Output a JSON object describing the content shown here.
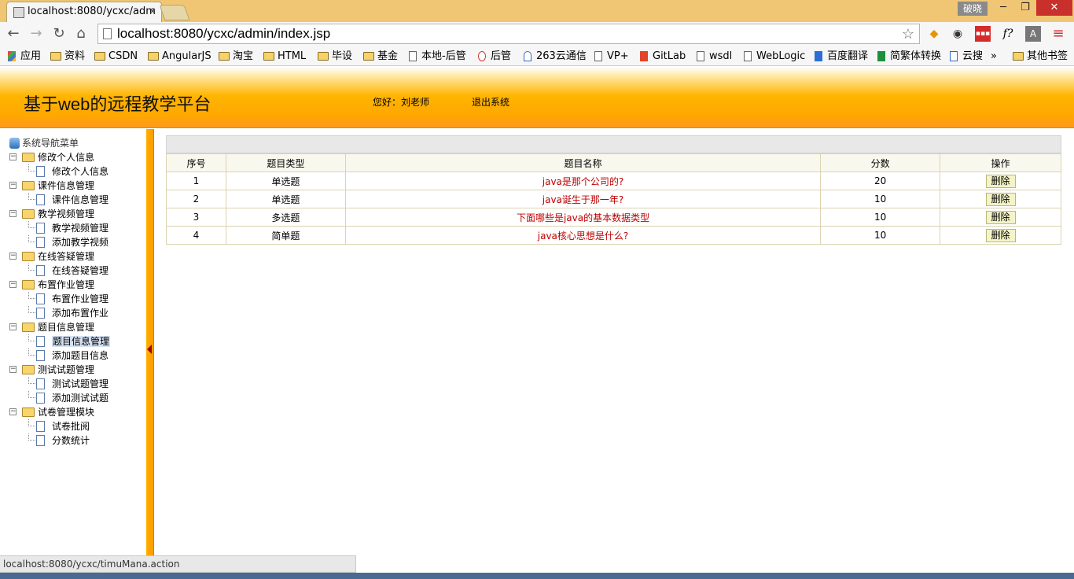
{
  "browser": {
    "tab_title": "localhost:8080/ycxc/adm",
    "tab_close": "×",
    "user_badge": "破晓",
    "window_min": "─",
    "window_max": "❐",
    "window_close": "✕",
    "nav_back": "←",
    "nav_forward": "→",
    "nav_reload": "↻",
    "nav_home": "⌂",
    "star": "☆",
    "url": "localhost:8080/ycxc/admin/index.jsp",
    "status_url": "localhost:8080/ycxc/timuMana.action",
    "bookmarks": [
      "应用",
      "资料",
      "CSDN",
      "AngularJS",
      "淘宝",
      "HTML",
      "毕设",
      "基金",
      "本地-后管",
      "后管",
      "263云通信",
      "VP+",
      "GitLab",
      "wsdl",
      "WebLogic",
      "百度翻译",
      "简繁体转换",
      "云搜",
      "»",
      "其他书签"
    ],
    "extensions": [
      "◆",
      "◉",
      "▪▪▪",
      "f?",
      "A",
      "≡"
    ]
  },
  "header": {
    "title": "基于web的远程教学平台",
    "greeting": "您好：刘老师",
    "logout": "退出系统"
  },
  "sidebar": {
    "root_label": "系统导航菜单",
    "folder_toggle": "−",
    "groups": [
      {
        "label": "修改个人信息",
        "items": [
          "修改个人信息"
        ]
      },
      {
        "label": "课件信息管理",
        "items": [
          "课件信息管理"
        ]
      },
      {
        "label": "教学视频管理",
        "items": [
          "教学视频管理",
          "添加教学视频"
        ]
      },
      {
        "label": "在线答疑管理",
        "items": [
          "在线答疑管理"
        ]
      },
      {
        "label": "布置作业管理",
        "items": [
          "布置作业管理",
          "添加布置作业"
        ]
      },
      {
        "label": "题目信息管理",
        "items": [
          "题目信息管理",
          "添加题目信息"
        ]
      },
      {
        "label": "测试试题管理",
        "items": [
          "测试试题管理",
          "添加测试试题"
        ]
      },
      {
        "label": "试卷管理模块",
        "items": [
          "试卷批阅",
          "分数统计"
        ]
      }
    ],
    "selected_item": "题目信息管理"
  },
  "table": {
    "headers": [
      "序号",
      "题目类型",
      "题目名称",
      "分数",
      "操作"
    ],
    "rows": [
      {
        "no": "1",
        "type": "单选题",
        "title": "java是那个公司的?",
        "score": "20",
        "action": "删除"
      },
      {
        "no": "2",
        "type": "单选题",
        "title": "java诞生于那一年?",
        "score": "10",
        "action": "删除"
      },
      {
        "no": "3",
        "type": "多选题",
        "title": "下面哪些是java的基本数据类型",
        "score": "10",
        "action": "删除"
      },
      {
        "no": "4",
        "type": "简单题",
        "title": "java核心思想是什么?",
        "score": "10",
        "action": "删除"
      }
    ]
  },
  "colors": {
    "header_orange": "#ffa800",
    "title_red": "#c00000",
    "sidebar_bar": "#ff9a00"
  }
}
